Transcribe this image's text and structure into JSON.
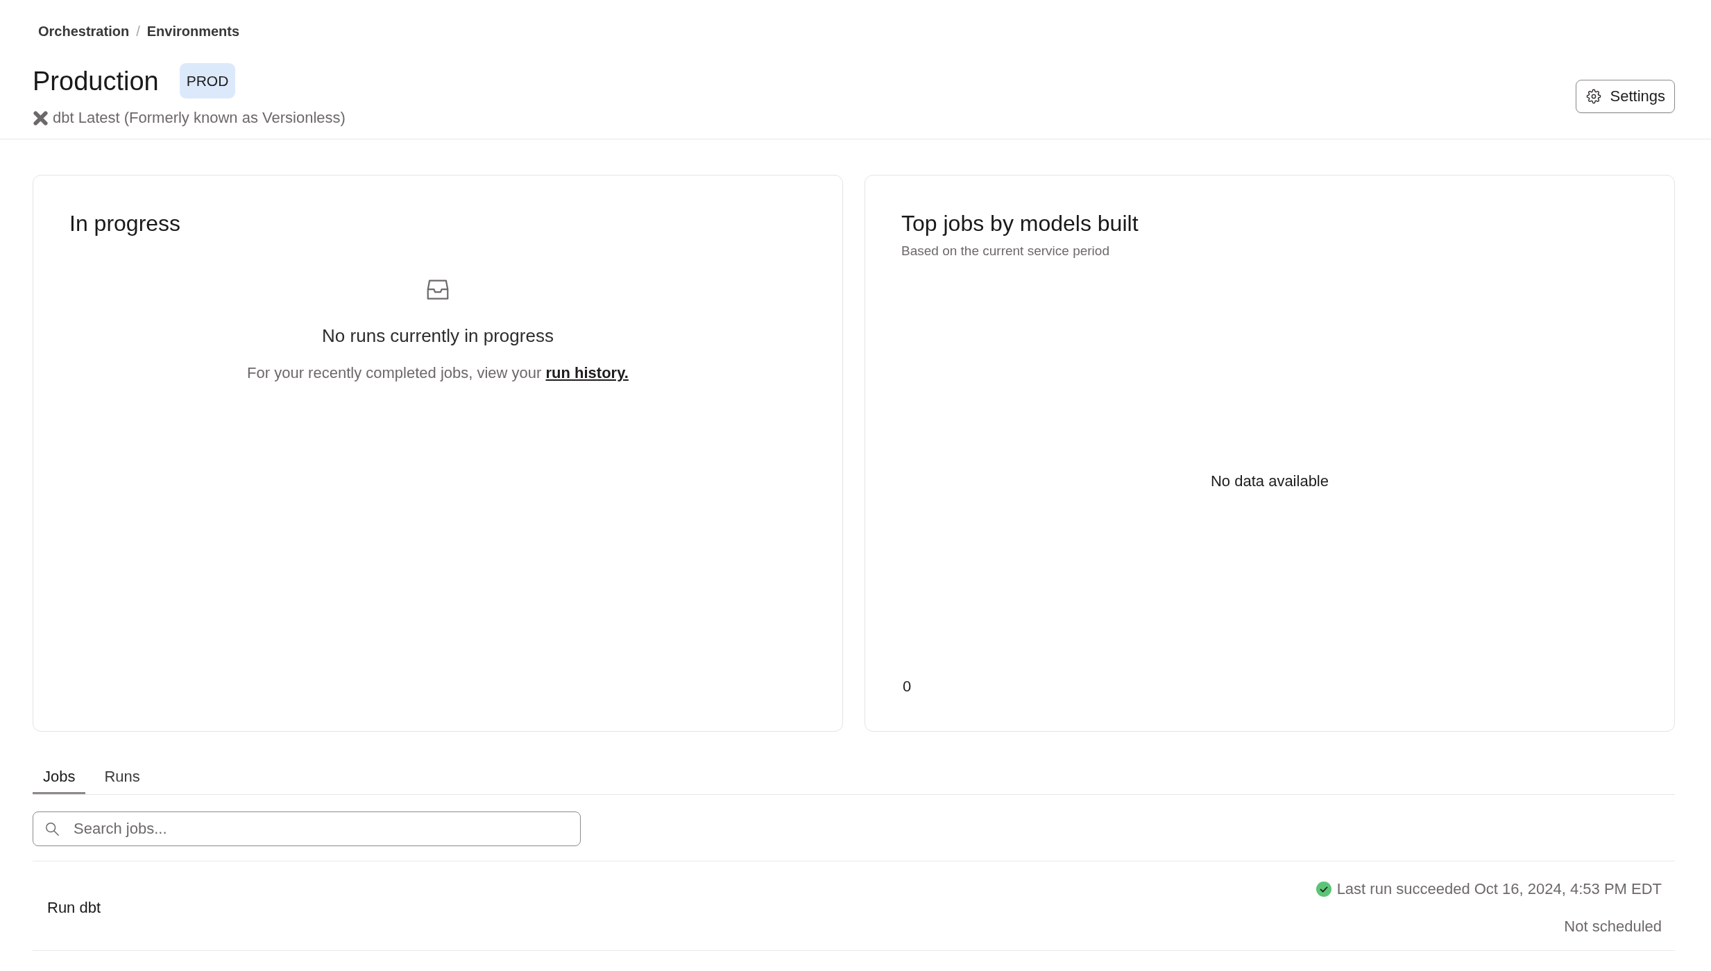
{
  "breadcrumb": {
    "items": [
      "Orchestration",
      "Environments"
    ],
    "separator": "/"
  },
  "environment": {
    "title": "Production",
    "badge": "PROD",
    "version": "dbt Latest (Formerly known as Versionless)"
  },
  "settings_button": {
    "label": "Settings"
  },
  "in_progress": {
    "title": "In progress",
    "empty_title": "No runs currently in progress",
    "empty_text": "For your recently completed jobs, view your",
    "link": "run history."
  },
  "top_jobs": {
    "title": "Top jobs by models built",
    "subtitle": "Based on the current service period",
    "empty_message": "No data available",
    "axis_tick": "0"
  },
  "tabs": [
    {
      "label": "Jobs",
      "selected": true
    },
    {
      "label": "Runs",
      "selected": false
    }
  ],
  "search": {
    "placeholder": "Search jobs..."
  },
  "jobs": [
    {
      "name": "Run dbt",
      "succeeded": true,
      "last_run": "Last run succeeded Oct 16, 2024, 4:53 PM EDT",
      "schedule": "Not scheduled"
    }
  ]
}
